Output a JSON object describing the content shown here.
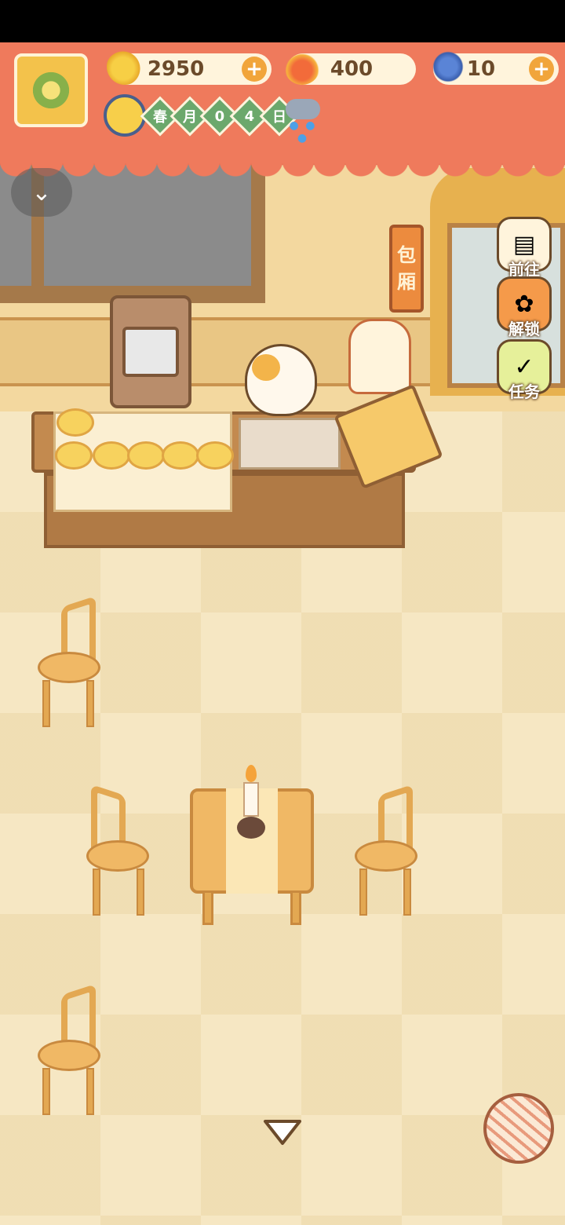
{
  "hud": {
    "currencies": [
      {
        "name": "banana",
        "value": "2950",
        "has_plus": true
      },
      {
        "name": "fire-pepper",
        "value": "400",
        "has_plus": false
      },
      {
        "name": "fish",
        "value": "10",
        "has_plus": true
      }
    ],
    "plus_symbol": "+",
    "date": {
      "chars": [
        "春",
        "月",
        "0",
        "4",
        "日"
      ]
    },
    "weather": "rain-cloud"
  },
  "controls": {
    "dropdown_symbol": "⌄"
  },
  "sign": {
    "chars": [
      "包",
      "厢"
    ]
  },
  "side_buttons": [
    {
      "label": "前往",
      "icon": "signboard-icon"
    },
    {
      "label": "解锁",
      "icon": "unlock-icon"
    },
    {
      "label": "任务",
      "icon": "task-icon"
    }
  ],
  "colors": {
    "hud": "#ef7a5c",
    "accent": "#f1a53b",
    "date_tile": "#6ba86c",
    "floor": "#f6e7c3"
  }
}
